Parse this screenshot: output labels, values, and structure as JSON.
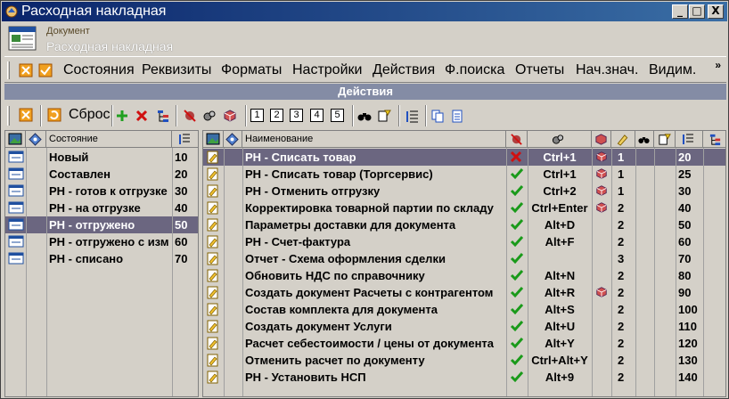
{
  "window": {
    "title": "Расходная накладная",
    "min": "_",
    "max": "□",
    "close": "X"
  },
  "header": {
    "subtitle": "Документ",
    "title": "Расходная накладная"
  },
  "menu": {
    "items": [
      "Состояния",
      "Реквизиты",
      "Форматы",
      "Настройки",
      "Действия",
      "Ф.поиска",
      "Отчеты",
      "Нач.знач.",
      "Видим."
    ],
    "more": "»"
  },
  "actions_bar": {
    "title": "Действия"
  },
  "toolbar": {
    "reset_label": "Сброс",
    "numbers": [
      "1",
      "2",
      "3",
      "4",
      "5"
    ]
  },
  "states_grid": {
    "header": {
      "state": "Состояние"
    },
    "rows": [
      {
        "name": "Новый",
        "order": "10"
      },
      {
        "name": "Составлен",
        "order": "20"
      },
      {
        "name": "РН - готов к отгрузке",
        "order": "30"
      },
      {
        "name": "РН - на отгрузке",
        "order": "40"
      },
      {
        "name": "РН - отгружено",
        "order": "50",
        "selected": true
      },
      {
        "name": "РН - отгружено с изм",
        "order": "60"
      },
      {
        "name": "РН - списано",
        "order": "70"
      }
    ]
  },
  "actions_grid": {
    "header": {
      "name": "Наименование"
    },
    "rows": [
      {
        "name": "РН - Списать товар",
        "status": "cross",
        "key": "Ctrl+1",
        "cube": true,
        "level": "1",
        "order": "20",
        "selected": true
      },
      {
        "name": "РН - Списать товар (Торгсервис)",
        "status": "check",
        "key": "Ctrl+1",
        "cube": true,
        "level": "1",
        "order": "25"
      },
      {
        "name": "РН - Отменить отгрузку",
        "status": "check",
        "key": "Ctrl+2",
        "cube": true,
        "level": "1",
        "order": "30"
      },
      {
        "name": "Корректировка товарной партии по складу",
        "status": "check",
        "key": "Ctrl+Enter",
        "cube": true,
        "level": "2",
        "order": "40"
      },
      {
        "name": "Параметры доставки для документа",
        "status": "check",
        "key": "Alt+D",
        "cube": false,
        "level": "2",
        "order": "50"
      },
      {
        "name": "РН - Счет-фактура",
        "status": "check",
        "key": "Alt+F",
        "cube": false,
        "level": "2",
        "order": "60"
      },
      {
        "name": "Отчет -  Схема оформления сделки",
        "status": "check",
        "key": "",
        "cube": false,
        "level": "3",
        "order": "70"
      },
      {
        "name": "Обновить НДС по справочнику",
        "status": "check",
        "key": "Alt+N",
        "cube": false,
        "level": "2",
        "order": "80"
      },
      {
        "name": "Создать документ Расчеты с контрагентом",
        "status": "check",
        "key": "Alt+R",
        "cube": true,
        "level": "2",
        "order": "90"
      },
      {
        "name": "Состав комплекта для документа",
        "status": "check",
        "key": "Alt+S",
        "cube": false,
        "level": "2",
        "order": "100"
      },
      {
        "name": "Создать документ Услуги",
        "status": "check",
        "key": "Alt+U",
        "cube": false,
        "level": "2",
        "order": "110"
      },
      {
        "name": "Расчет себестоимости / цены от документа",
        "status": "check",
        "key": "Alt+Y",
        "cube": false,
        "level": "2",
        "order": "120"
      },
      {
        "name": "Отменить расчет по документу",
        "status": "check",
        "key": "Ctrl+Alt+Y",
        "cube": false,
        "level": "2",
        "order": "130"
      },
      {
        "name": "РН - Установить НСП",
        "status": "check",
        "key": "Alt+9",
        "cube": false,
        "level": "2",
        "order": "140"
      }
    ]
  },
  "colors": {
    "titlebar": "#0a246a",
    "selected_row": "#6b6680",
    "check": "#1a9a1a",
    "cross": "#d01010",
    "actions_bar": "#848ca5"
  }
}
